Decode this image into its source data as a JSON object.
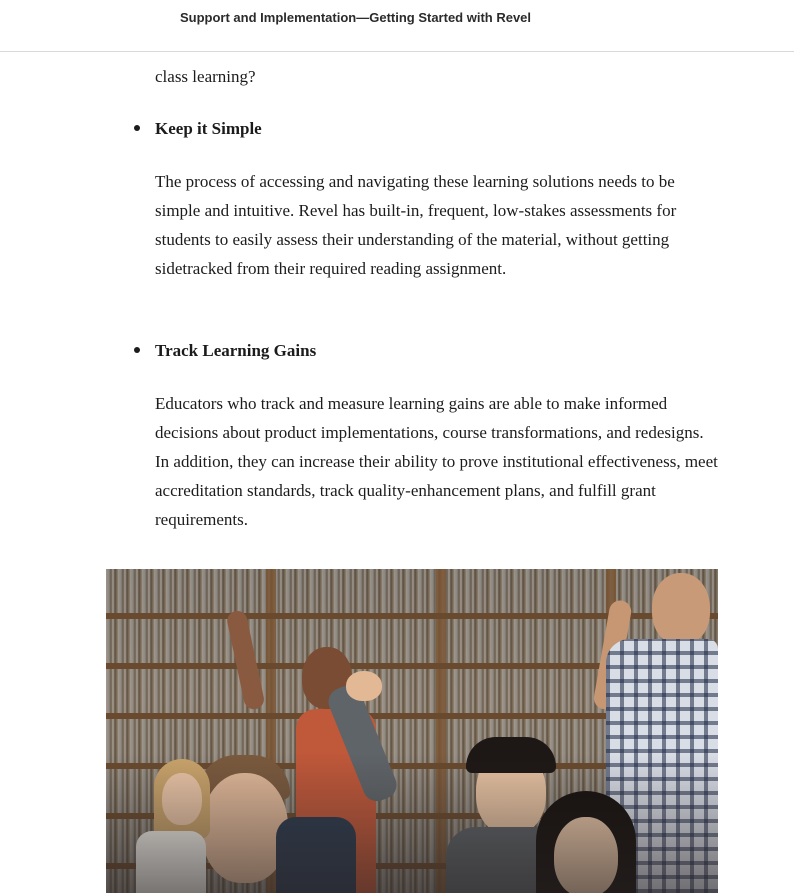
{
  "header": {
    "title": "Support and Implementation—Getting Started with Revel"
  },
  "content": {
    "partial_line_tail": "class learning?",
    "sections": [
      {
        "heading": "Keep it Simple",
        "body": "The process of accessing and navigating these learning solutions needs to be simple and intuitive. Revel has built-in, frequent, low-stakes assessments for students to easily assess their understanding of the material, without getting sidetracked from their required reading assignment."
      },
      {
        "heading": "Track Learning Gains",
        "body": "Educators who track and measure learning gains are able to make informed decisions about product implementations, course transformations, and redesigns. In addition, they can increase their ability to prove institutional effectiveness, meet accreditation standards, track quality-enhancement plans, and fulfill grant requirements."
      }
    ]
  },
  "colors": {
    "text": "#1c1c1c",
    "header_border": "#d9d9d9"
  }
}
